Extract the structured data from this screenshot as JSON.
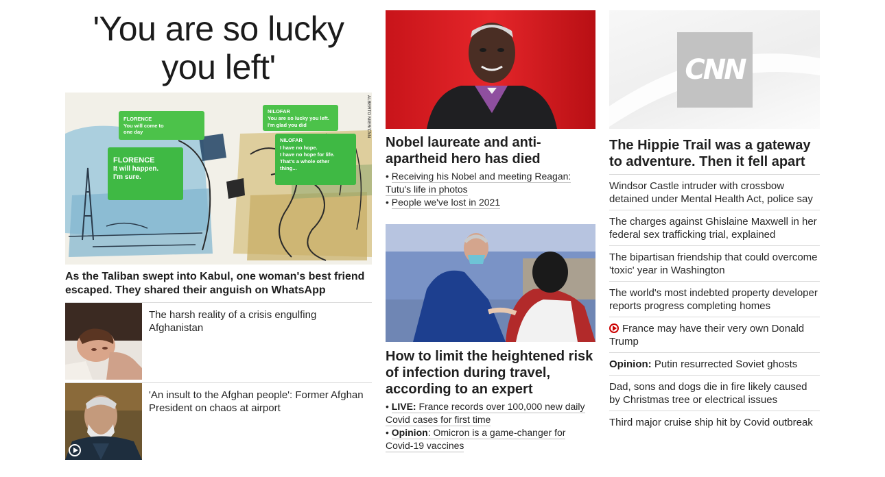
{
  "col1": {
    "headline": "'You are so lucky you left'",
    "illustration": {
      "credit": "ALBERTO MIER/CNN",
      "bubbles": [
        {
          "name": "FLORENCE",
          "text": "You will come to one day"
        },
        {
          "name": "FLORENCE",
          "text": "It will happen. I'm sure."
        },
        {
          "name": "NILOFAR",
          "text": "You are so lucky you left. I'm glad you did"
        },
        {
          "name": "NILOFAR",
          "text": "I have no hope. I have no hope for life. That's a whole other thing..."
        }
      ]
    },
    "caption": "As the Taliban swept into Kabul, one woman's best friend escaped. They shared their anguish on WhatsApp",
    "items": [
      {
        "text": "The harsh reality of a crisis engulfing Afghanistan",
        "icon": "child-photo"
      },
      {
        "text": "'An insult to the Afghan people': Former Afghan President on chaos at airport",
        "icon": "play-icon"
      }
    ]
  },
  "col2": {
    "story1": {
      "headline": "Nobel laureate and anti-apartheid hero has died",
      "related": [
        "Receiving his Nobel and meeting Reagan: Tutu's life in photos",
        "People we've lost in 2021"
      ]
    },
    "story2": {
      "headline": "How to limit the heightened risk of infection during travel, according to an expert",
      "related": [
        {
          "prefix": "LIVE:",
          "text": "France records over 100,000 new daily Covid cases for first time"
        },
        {
          "prefix": "Opinion",
          "text": ": Omicron is a game-changer for Covid-19 vaccines"
        }
      ]
    }
  },
  "col3": {
    "logo_text": "CNN",
    "headline": "The Hippie Trail was a gateway to adventure. Then it fell apart",
    "stories": [
      {
        "text": "Windsor Castle intruder with crossbow detained under Mental Health Act, police say"
      },
      {
        "text": "The charges against Ghislaine Maxwell in her federal sex trafficking trial, explained"
      },
      {
        "text": "The bipartisan friendship that could overcome 'toxic' year in Washington"
      },
      {
        "text": "The world's most indebted property developer reports progress completing homes"
      },
      {
        "text": "France may have their very own Donald Trump",
        "icon": "video-play-icon"
      },
      {
        "prefix": "Opinion:",
        "text": " Putin resurrected Soviet ghosts"
      },
      {
        "text": "Dad, sons and dogs die in fire likely caused by Christmas tree or electrical issues"
      },
      {
        "text": "Third major cruise ship hit by Covid outbreak"
      }
    ]
  },
  "colors": {
    "text": "#262626",
    "divider": "#d9d9d9",
    "video_red": "#cc0000",
    "bubble_green": "#4cc24a"
  }
}
